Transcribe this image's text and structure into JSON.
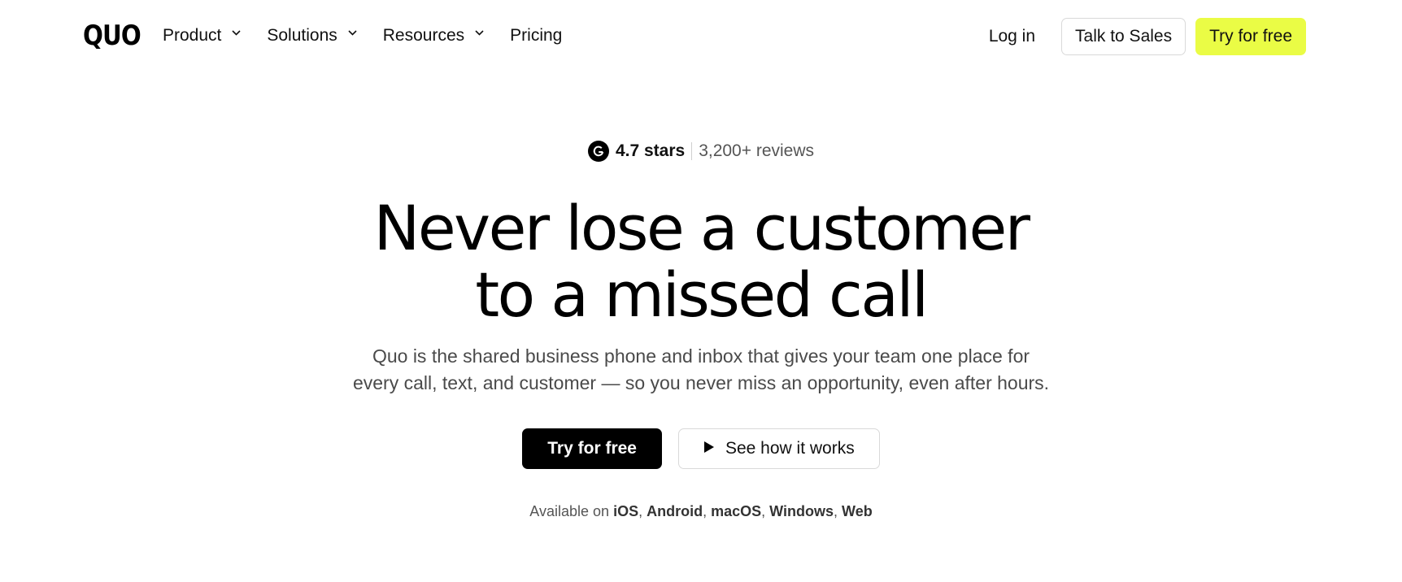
{
  "nav": {
    "logo": "QUO",
    "links": [
      {
        "label": "Product",
        "has_dropdown": true
      },
      {
        "label": "Solutions",
        "has_dropdown": true
      },
      {
        "label": "Resources",
        "has_dropdown": true
      },
      {
        "label": "Pricing",
        "has_dropdown": false
      }
    ],
    "login_label": "Log in",
    "sales_label": "Talk to Sales",
    "try_label": "Try for free"
  },
  "hero": {
    "rating_badge_icon": "g2-logo-icon",
    "rating": "4.7 stars",
    "reviews": "3,200+ reviews",
    "headline_line1": "Never lose a customer",
    "headline_line2": "to a missed call",
    "subhead_line1": "Quo is the shared business phone and inbox that gives your team one place for",
    "subhead_line2": "every call, text, and customer — so you never miss an opportunity, even after hours.",
    "primary_cta": "Try for free",
    "secondary_cta": "See how it works",
    "secondary_cta_icon": "play-icon",
    "available_prefix": "Available on",
    "platforms": [
      "iOS",
      "Android",
      "macOS",
      "Windows",
      "Web"
    ]
  },
  "colors": {
    "accent": "#eafc45",
    "primary_button": "#000000",
    "background": "#ffffff"
  }
}
